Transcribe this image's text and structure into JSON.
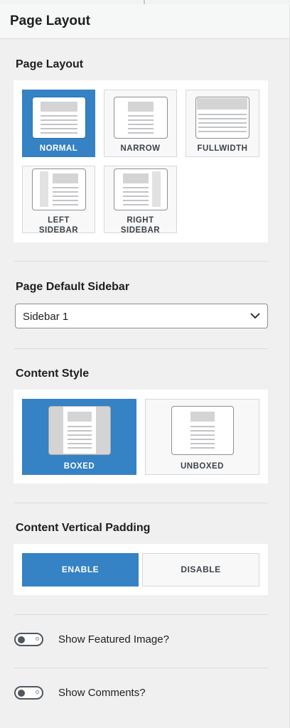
{
  "panel": {
    "title": "Page Layout"
  },
  "page_layout": {
    "title": "Page Layout",
    "options": [
      {
        "label": "NORMAL",
        "selected": true
      },
      {
        "label": "NARROW",
        "selected": false
      },
      {
        "label": "FULLWIDTH",
        "selected": false
      },
      {
        "label_line1": "LEFT",
        "label_line2": "SIDEBAR",
        "selected": false
      },
      {
        "label_line1": "RIGHT",
        "label_line2": "SIDEBAR",
        "selected": false
      }
    ]
  },
  "default_sidebar": {
    "title": "Page Default Sidebar",
    "selected": "Sidebar 1"
  },
  "content_style": {
    "title": "Content Style",
    "options": [
      {
        "label": "BOXED",
        "selected": true
      },
      {
        "label": "UNBOXED",
        "selected": false
      }
    ]
  },
  "vertical_padding": {
    "title": "Content Vertical Padding",
    "enable_label": "ENABLE",
    "disable_label": "DISABLE",
    "value": "ENABLE"
  },
  "toggles": [
    {
      "label": "Show Featured Image?",
      "on": false
    },
    {
      "label": "Show Comments?",
      "on": false
    }
  ],
  "colors": {
    "accent": "#3582c4",
    "panel_bg": "#f0f0f1",
    "border": "#dcdcde"
  }
}
